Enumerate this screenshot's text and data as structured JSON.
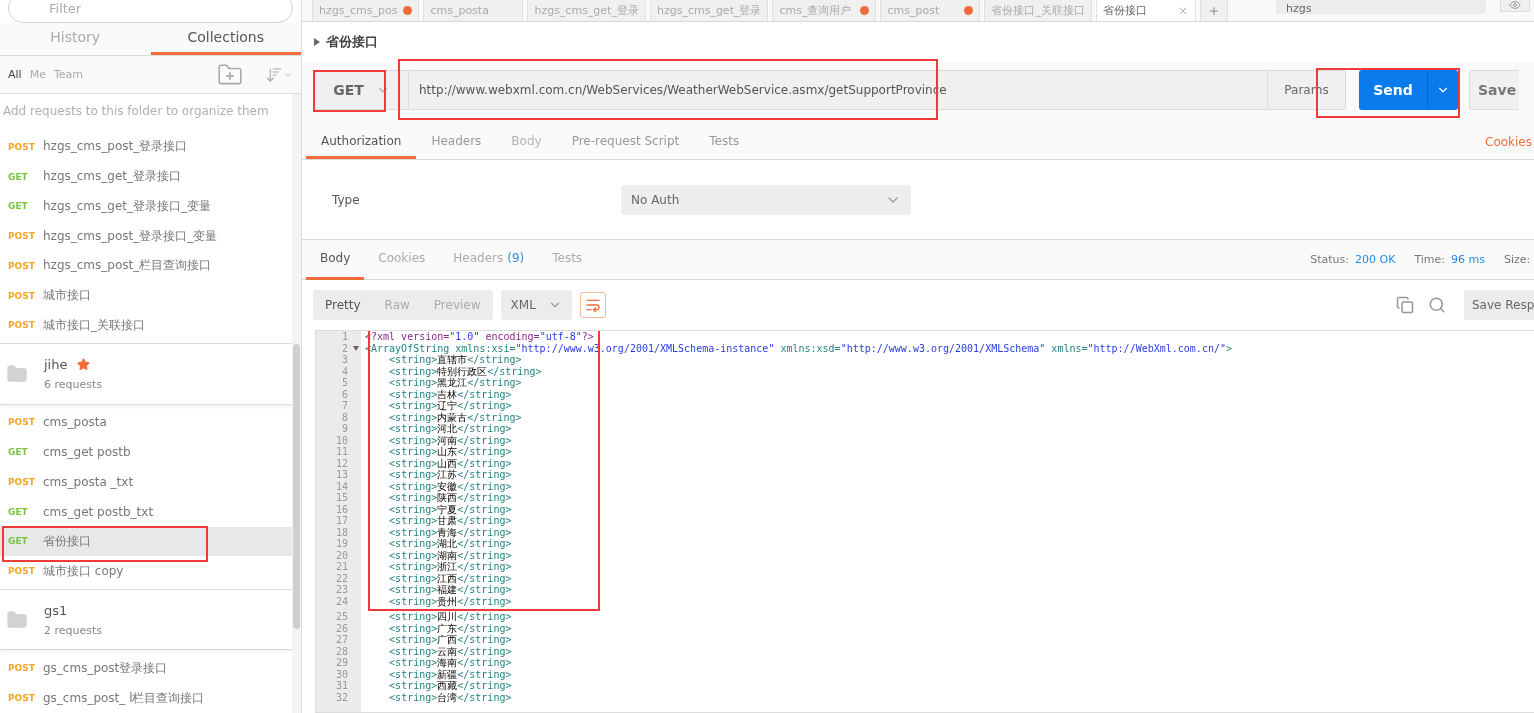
{
  "sidebar": {
    "filter": {
      "placeholder": "Filter"
    },
    "tabs": [
      {
        "label": "History",
        "selected": false
      },
      {
        "label": "Collections",
        "selected": true
      }
    ],
    "owner_filters": [
      {
        "label": "All",
        "selected": true
      },
      {
        "label": "Me",
        "selected": false
      },
      {
        "label": "Team",
        "selected": false
      }
    ],
    "hint": "Add requests to this folder to organize them",
    "entries": [
      {
        "kind": "request",
        "method": "POST",
        "color": "#f5a623",
        "name": "hzgs_cms_post_登录接口",
        "selected": false,
        "highlighted": false
      },
      {
        "kind": "request",
        "method": "GET",
        "color": "#7cc242",
        "name": "hzgs_cms_get_登录接口",
        "selected": false,
        "highlighted": false
      },
      {
        "kind": "request",
        "method": "GET",
        "color": "#7cc242",
        "name": "hzgs_cms_get_登录接口_变量",
        "selected": false,
        "highlighted": false
      },
      {
        "kind": "request",
        "method": "POST",
        "color": "#f5a623",
        "name": "hzgs_cms_post_登录接口_变量",
        "selected": false,
        "highlighted": false
      },
      {
        "kind": "request",
        "method": "POST",
        "color": "#f5a623",
        "name": "hzgs_cms_post_栏目查询接口",
        "selected": false,
        "highlighted": false
      },
      {
        "kind": "request",
        "method": "POST",
        "color": "#f5a623",
        "name": "城市接口",
        "selected": false,
        "highlighted": false
      },
      {
        "kind": "request",
        "method": "POST",
        "color": "#f5a623",
        "name": "城市接口_关联接口",
        "selected": false,
        "highlighted": false
      },
      {
        "kind": "collection",
        "name": "jihe",
        "count": "6 requests",
        "starred": true
      },
      {
        "kind": "request",
        "method": "POST",
        "color": "#f5a623",
        "name": "cms_posta",
        "selected": false,
        "highlighted": false
      },
      {
        "kind": "request",
        "method": "GET",
        "color": "#7cc242",
        "name": "cms_get postb",
        "selected": false,
        "highlighted": false
      },
      {
        "kind": "request",
        "method": "POST",
        "color": "#f5a623",
        "name": "cms_posta _txt",
        "selected": false,
        "highlighted": false
      },
      {
        "kind": "request",
        "method": "GET",
        "color": "#7cc242",
        "name": "cms_get postb_txt",
        "selected": false,
        "highlighted": false
      },
      {
        "kind": "request",
        "method": "GET",
        "color": "#7cc242",
        "name": "省份接口",
        "selected": true,
        "highlighted": true
      },
      {
        "kind": "request",
        "method": "POST",
        "color": "#f5a623",
        "name": "城市接口 copy",
        "selected": false,
        "highlighted": false
      },
      {
        "kind": "collection",
        "name": "gs1",
        "count": "2 requests",
        "starred": false
      },
      {
        "kind": "request",
        "method": "POST",
        "color": "#f5a623",
        "name": "gs_cms_post登录接口",
        "selected": false,
        "highlighted": false
      },
      {
        "kind": "request",
        "method": "POST",
        "color": "#f5a623",
        "name": "gs_cms_post_ l栏目查询接口",
        "selected": false,
        "highlighted": false
      }
    ]
  },
  "request_tabs": [
    {
      "label": "hzgs_cms_pos",
      "unsaved": true,
      "selected": false
    },
    {
      "label": "cms_posta",
      "unsaved": false,
      "selected": false
    },
    {
      "label": "hzgs_cms_get_登录",
      "unsaved": false,
      "selected": false
    },
    {
      "label": "hzgs_cms_get_登录",
      "unsaved": false,
      "selected": false
    },
    {
      "label": "cms_查询用户",
      "unsaved": true,
      "selected": false
    },
    {
      "label": "cms_post",
      "unsaved": true,
      "selected": false
    },
    {
      "label": "省份接口_关联接口",
      "unsaved": false,
      "selected": false
    },
    {
      "label": "省份接口",
      "unsaved": false,
      "selected": true
    }
  ],
  "environment": {
    "value": "hzgs"
  },
  "request": {
    "title": "省份接口",
    "method": "GET",
    "method_highlighted": true,
    "url": "http://www.webxml.com.cn/WebServices/WeatherWebService.asmx/getSupportProvince",
    "url_highlighted": true,
    "params_label": "Params",
    "send_label": "Send",
    "send_highlighted": true,
    "save_label": "Save",
    "tabs": [
      {
        "label": "Authorization",
        "selected": true,
        "disabled": false
      },
      {
        "label": "Headers",
        "selected": false,
        "disabled": false
      },
      {
        "label": "Body",
        "selected": false,
        "disabled": true
      },
      {
        "label": "Pre-request Script",
        "selected": false,
        "disabled": false
      },
      {
        "label": "Tests",
        "selected": false,
        "disabled": false
      }
    ],
    "cookies_link": "Cookies",
    "auth": {
      "label": "Type",
      "value": "No Auth"
    }
  },
  "response": {
    "tabs": [
      {
        "label": "Body",
        "selected": true
      },
      {
        "label": "Cookies",
        "selected": false
      },
      {
        "label": "Headers",
        "count": "(9)",
        "selected": false
      },
      {
        "label": "Tests",
        "selected": false
      }
    ],
    "status": {
      "label": "Status:",
      "value": "200 OK"
    },
    "time": {
      "label": "Time:",
      "value": "96 ms"
    },
    "size": {
      "label": "Size:"
    },
    "views": [
      {
        "label": "Pretty",
        "selected": true
      },
      {
        "label": "Raw",
        "selected": false
      },
      {
        "label": "Preview",
        "selected": false
      }
    ],
    "format": "XML",
    "save_label": "Save Resp",
    "highlighted_lines": [
      {
        "number": "1",
        "text": "<?xml version=\"1.0\" encoding=\"utf-8\"?>",
        "foldable": false
      },
      {
        "number": "2",
        "text": "<ArrayOfString xmlns:xsi=\"http://www.w3.org/2001/XMLSchema-instance\" xmlns:xsd=\"http://www.w3.org/2001/XMLSchema\" xmlns=\"http://WebXml.com.cn/\">",
        "foldable": true
      },
      {
        "number": "3",
        "text": "    <string>直辖市</string>",
        "foldable": false
      },
      {
        "number": "4",
        "text": "    <string>特别行政区</string>",
        "foldable": false
      },
      {
        "number": "5",
        "text": "    <string>黑龙江</string>",
        "foldable": false
      },
      {
        "number": "6",
        "text": "    <string>吉林</string>",
        "foldable": false
      },
      {
        "number": "7",
        "text": "    <string>辽宁</string>",
        "foldable": false
      },
      {
        "number": "8",
        "text": "    <string>内蒙古</string>",
        "foldable": false
      },
      {
        "number": "9",
        "text": "    <string>河北</string>",
        "foldable": false
      },
      {
        "number": "10",
        "text": "    <string>河南</string>",
        "foldable": false
      },
      {
        "number": "11",
        "text": "    <string>山东</string>",
        "foldable": false
      },
      {
        "number": "12",
        "text": "    <string>山西</string>",
        "foldable": false
      },
      {
        "number": "13",
        "text": "    <string>江苏</string>",
        "foldable": false
      },
      {
        "number": "14",
        "text": "    <string>安徽</string>",
        "foldable": false
      },
      {
        "number": "15",
        "text": "    <string>陕西</string>",
        "foldable": false
      },
      {
        "number": "16",
        "text": "    <string>宁夏</string>",
        "foldable": false
      },
      {
        "number": "17",
        "text": "    <string>甘肃</string>",
        "foldable": false
      },
      {
        "number": "18",
        "text": "    <string>青海</string>",
        "foldable": false
      },
      {
        "number": "19",
        "text": "    <string>湖北</string>",
        "foldable": false
      },
      {
        "number": "20",
        "text": "    <string>湖南</string>",
        "foldable": false
      },
      {
        "number": "21",
        "text": "    <string>浙江</string>",
        "foldable": false
      },
      {
        "number": "22",
        "text": "    <string>江西</string>",
        "foldable": false
      },
      {
        "number": "23",
        "text": "    <string>福建</string>",
        "foldable": false
      },
      {
        "number": "24",
        "text": "    <string>贵州</string>",
        "foldable": false
      }
    ],
    "lines": [
      {
        "number": "25",
        "text": "    <string>四川</string>",
        "foldable": false
      },
      {
        "number": "26",
        "text": "    <string>广东</string>",
        "foldable": false
      },
      {
        "number": "27",
        "text": "    <string>广西</string>",
        "foldable": false
      },
      {
        "number": "28",
        "text": "    <string>云南</string>",
        "foldable": false
      },
      {
        "number": "29",
        "text": "    <string>海南</string>",
        "foldable": false
      },
      {
        "number": "30",
        "text": "    <string>新疆</string>",
        "foldable": false
      },
      {
        "number": "31",
        "text": "    <string>西藏</string>",
        "foldable": false
      },
      {
        "number": "32",
        "text": "    <string>台湾</string>",
        "foldable": false
      }
    ]
  }
}
